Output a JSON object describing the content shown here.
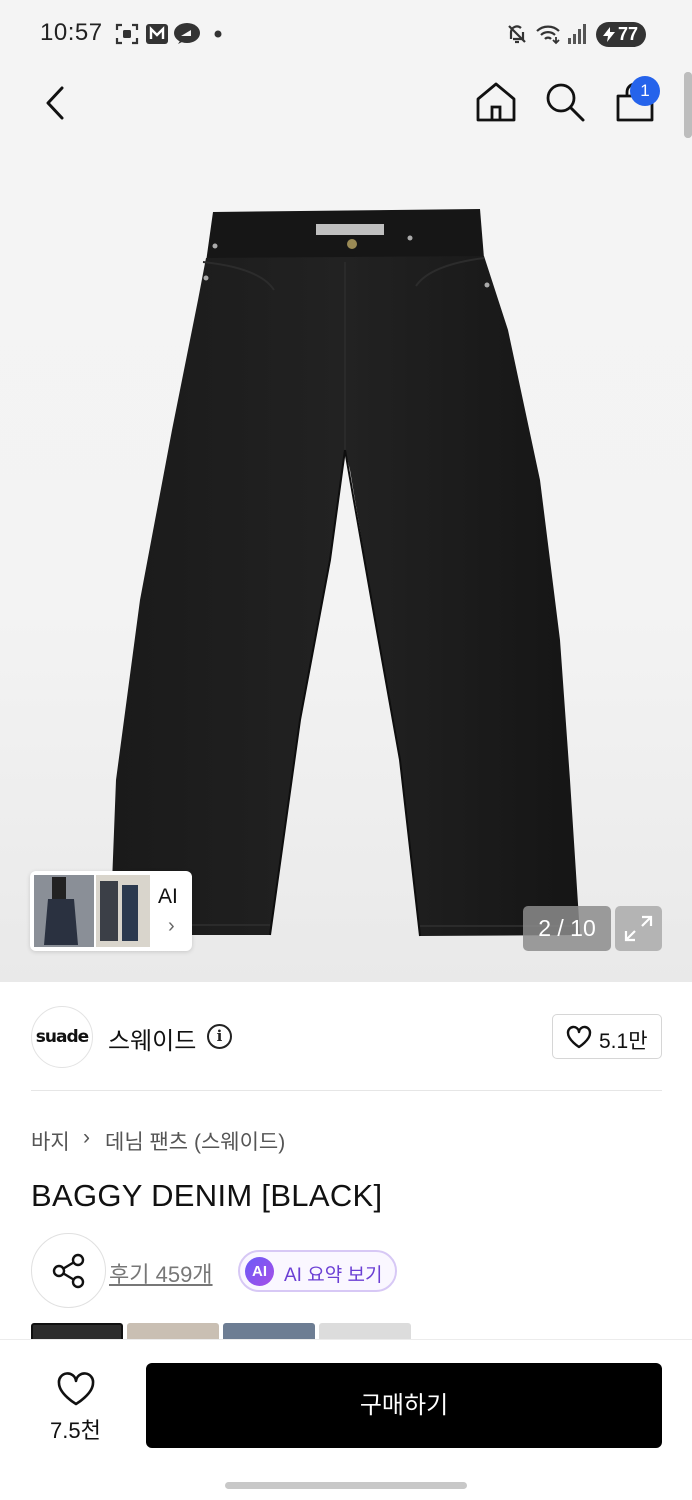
{
  "status_bar": {
    "time": "10:57",
    "battery": "77",
    "icons": [
      "screenshot-icon",
      "gmail-icon",
      "kakao-icon",
      "dot-icon",
      "mute-icon",
      "wifi-icon",
      "signal-icon"
    ]
  },
  "header": {
    "back_icon": "chevron-left-icon",
    "home_icon": "home-icon",
    "search_icon": "search-icon",
    "cart_icon": "shopping-bag-icon",
    "cart_count": "1"
  },
  "gallery": {
    "ai_label": "AI",
    "pager": "2 / 10",
    "current_index": 2,
    "total": 10
  },
  "brand": {
    "logo_text": "suade",
    "name": "스웨이드",
    "like_count": "5.1만"
  },
  "product": {
    "breadcrumb": [
      "바지",
      "데님 팬츠 (스웨이드)"
    ],
    "title": "BAGGY DENIM [BLACK]",
    "review_link": "후기 459개",
    "ai_badge": "AI",
    "ai_summary_label": "AI 요약 보기"
  },
  "bottom_bar": {
    "wish_count": "7.5천",
    "buy_label": "구매하기"
  },
  "colors": {
    "accent_blue": "#2563eb",
    "ai_purple": "#6b3fd4",
    "buy_button": "#000000"
  }
}
